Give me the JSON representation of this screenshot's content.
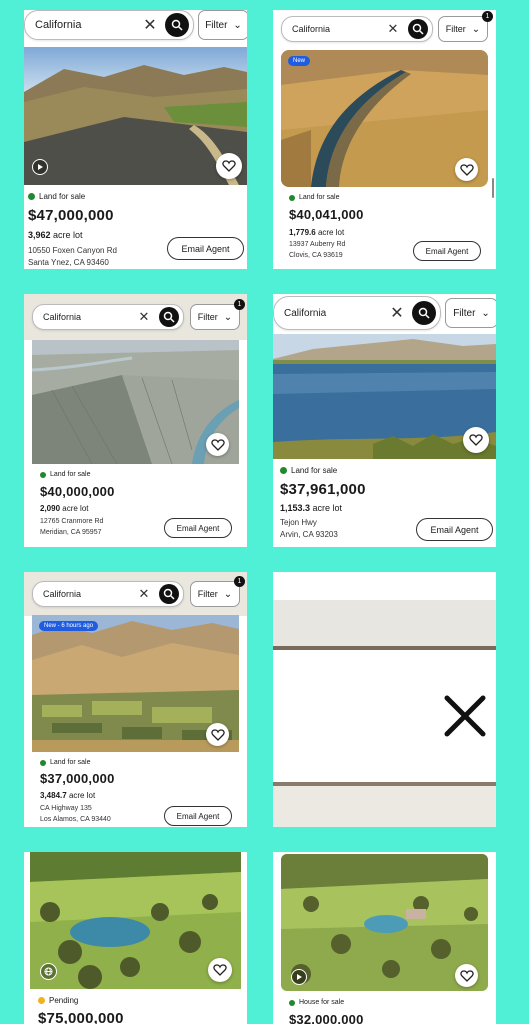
{
  "colors": {
    "background": "#4ff0d6",
    "status_green": "#1e8a2e",
    "status_yellow": "#f2b21b",
    "new_tag": "#1f5ce0"
  },
  "search": {
    "query": "California",
    "filter_label": "Filter",
    "filter_count": "1"
  },
  "listings": [
    {
      "status": "Land for sale",
      "price": "$47,000,000",
      "lot_size": "3,962",
      "lot_unit": "acre lot",
      "address1": "10550 Foxen Canyon Rd",
      "address2": "Santa Ynez, CA 93460",
      "email": "Email Agent"
    },
    {
      "tag": "New",
      "status": "Land for sale",
      "price": "$40,041,000",
      "lot_size": "1,779.6",
      "lot_unit": "acre lot",
      "address1": "13937 Auberry Rd",
      "address2": "Clovis, CA 93619",
      "email": "Email Agent"
    },
    {
      "status": "Land for sale",
      "price": "$40,000,000",
      "lot_size": "2,090",
      "lot_unit": "acre lot",
      "address1": "12765 Cranmore Rd",
      "address2": "Meridian, CA 95957",
      "email": "Email Agent"
    },
    {
      "status": "Land for sale",
      "price": "$37,961,000",
      "lot_size": "1,153.3",
      "lot_unit": "acre lot",
      "address1": "Tejon Hwy",
      "address2": "Arvin, CA 93203",
      "email": "Email Agent"
    },
    {
      "tag": "New - 6 hours ago",
      "status": "Land for sale",
      "price": "$37,000,000",
      "lot_size": "3,484.7",
      "lot_unit": "acre lot",
      "address1": "CA Highway 135",
      "address2": "Los Alamos, CA 93440",
      "email": "Email Agent"
    },
    {
      "status": "Pending",
      "price": "$75,000,000"
    },
    {
      "status": "House for sale",
      "price": "$32,000,000"
    }
  ]
}
